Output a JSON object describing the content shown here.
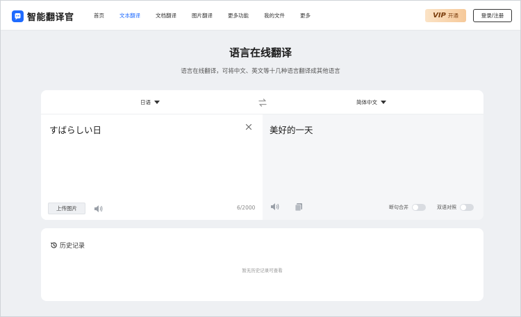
{
  "brand": {
    "name": "智能翻译官"
  },
  "nav": {
    "items": [
      {
        "label": "首页",
        "active": false
      },
      {
        "label": "文本翻译",
        "active": true
      },
      {
        "label": "文档翻译",
        "active": false
      },
      {
        "label": "图片翻译",
        "active": false
      },
      {
        "label": "更多功能",
        "active": false
      },
      {
        "label": "我的文件",
        "active": false
      },
      {
        "label": "更多",
        "active": false
      }
    ]
  },
  "header": {
    "vip_main": "VIP",
    "vip_sub": "开通",
    "login_label": "登录/注册"
  },
  "hero": {
    "title": "语言在线翻译",
    "subtitle": "语言在线翻译，可将中文、英文等十几种语言翻译成其他语言"
  },
  "translator": {
    "source_lang": "日语",
    "target_lang": "简体中文",
    "source_text": "すばらしい日",
    "target_text": "美好的一天",
    "upload_label": "上传图片",
    "char_count": "6/2000",
    "option_merge": "断句合并",
    "option_compare": "双语对照"
  },
  "history": {
    "title": "历史记录",
    "empty_text": "暂无历史记录可查看"
  },
  "colors": {
    "accent": "#1f6bff",
    "background": "#eef0f3",
    "vip_gradient_start": "#fbe3c6",
    "vip_gradient_end": "#f6c99a"
  },
  "icons": [
    "logo-icon",
    "chevron-down-icon",
    "swap-icon",
    "close-icon",
    "speaker-icon",
    "copy-icon",
    "history-icon"
  ]
}
